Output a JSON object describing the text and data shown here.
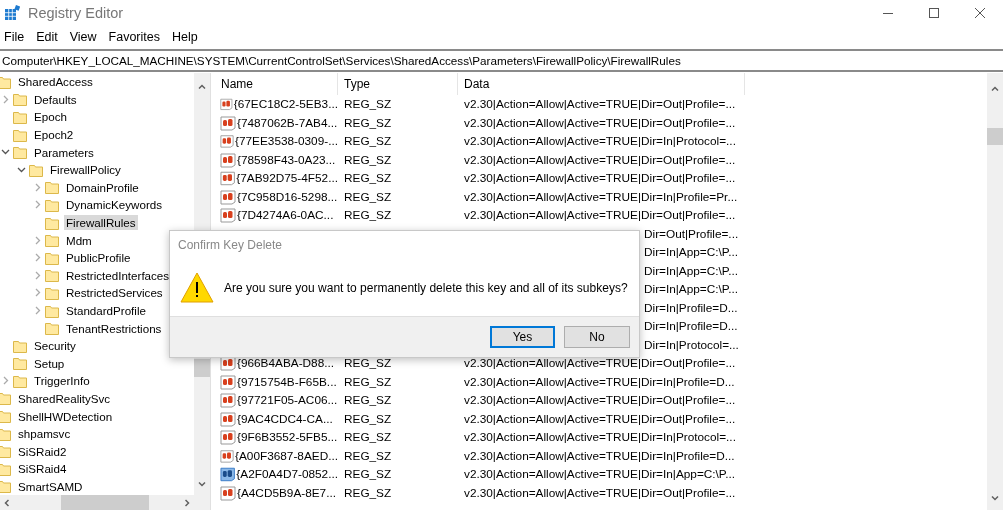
{
  "window": {
    "title": "Registry Editor"
  },
  "menu": [
    "File",
    "Edit",
    "View",
    "Favorites",
    "Help"
  ],
  "address": "Computer\\HKEY_LOCAL_MACHINE\\SYSTEM\\CurrentControlSet\\Services\\SharedAccess\\Parameters\\FirewallPolicy\\FirewallRules",
  "tree": [
    {
      "label": "SharedAccess",
      "selected": false,
      "children": [
        {
          "label": "Defaults",
          "expanded": false,
          "selected": false
        },
        {
          "label": "Epoch",
          "selected": false
        },
        {
          "label": "Epoch2",
          "selected": false
        },
        {
          "label": "Parameters",
          "expanded": true,
          "selected": false,
          "children": [
            {
              "label": "FirewallPolicy",
              "expanded": true,
              "selected": false,
              "children": [
                {
                  "label": "DomainProfile",
                  "expanded": false,
                  "selected": false
                },
                {
                  "label": "DynamicKeywords",
                  "expanded": false,
                  "selected": false
                },
                {
                  "label": "FirewallRules",
                  "selected": true
                },
                {
                  "label": "Mdm",
                  "expanded": false,
                  "selected": false
                },
                {
                  "label": "PublicProfile",
                  "expanded": false,
                  "selected": false
                },
                {
                  "label": "RestrictedInterfaces",
                  "expanded": false,
                  "selected": false
                },
                {
                  "label": "RestrictedServices",
                  "expanded": false,
                  "selected": false
                },
                {
                  "label": "StandardProfile",
                  "expanded": false,
                  "selected": false
                },
                {
                  "label": "TenantRestrictions",
                  "selected": false
                }
              ]
            }
          ]
        },
        {
          "label": "Security",
          "selected": false
        },
        {
          "label": "Setup",
          "selected": false
        },
        {
          "label": "TriggerInfo",
          "expanded": false,
          "selected": false
        }
      ]
    },
    {
      "label": "SharedRealitySvc",
      "selected": false
    },
    {
      "label": "ShellHWDetection",
      "selected": false
    },
    {
      "label": "shpamsvc",
      "selected": false
    },
    {
      "label": "SiSRaid2",
      "selected": false
    },
    {
      "label": "SiSRaid4",
      "selected": false
    },
    {
      "label": "SmartSAMD",
      "selected": false
    }
  ],
  "table": {
    "columns": [
      "Name",
      "Type",
      "Data"
    ],
    "rows": [
      {
        "kind": "value",
        "name": "{67EC18C2-5EB3...",
        "type": "REG_SZ",
        "data": "v2.30|Action=Allow|Active=TRUE|Dir=Out|Profile=...",
        "selected": false
      },
      {
        "kind": "value",
        "name": "{7487062B-7AB4...",
        "type": "REG_SZ",
        "data": "v2.30|Action=Allow|Active=TRUE|Dir=Out|Profile=...",
        "selected": false
      },
      {
        "kind": "value",
        "name": "{77EE3538-0309-...",
        "type": "REG_SZ",
        "data": "v2.30|Action=Allow|Active=TRUE|Dir=In|Protocol=...",
        "selected": false
      },
      {
        "kind": "value",
        "name": "{78598F43-0A23...",
        "type": "REG_SZ",
        "data": "v2.30|Action=Allow|Active=TRUE|Dir=Out|Profile=...",
        "selected": false
      },
      {
        "kind": "value",
        "name": "{7AB92D75-4F52...",
        "type": "REG_SZ",
        "data": "v2.30|Action=Allow|Active=TRUE|Dir=Out|Profile=...",
        "selected": false
      },
      {
        "kind": "value",
        "name": "{7C958D16-5298...",
        "type": "REG_SZ",
        "data": "v2.30|Action=Allow|Active=TRUE|Dir=In|Profile=Pr...",
        "selected": false
      },
      {
        "kind": "value",
        "name": "{7D4274A6-0AC...",
        "type": "REG_SZ",
        "data": "v2.30|Action=Allow|Active=TRUE|Dir=Out|Profile=...",
        "selected": false
      },
      {
        "kind": "covered",
        "data": "Dir=Out|Profile=..."
      },
      {
        "kind": "covered",
        "data": "Dir=In|App=C:\\P..."
      },
      {
        "kind": "covered",
        "data": "Dir=In|App=C:\\P..."
      },
      {
        "kind": "covered",
        "data": "Dir=In|App=C:\\P..."
      },
      {
        "kind": "covered",
        "data": "Dir=In|Profile=D..."
      },
      {
        "kind": "covered",
        "data": "Dir=In|Profile=D..."
      },
      {
        "kind": "covered",
        "data": "Dir=In|Protocol=..."
      },
      {
        "kind": "value",
        "name": "{966B4ABA-D88...",
        "type": "REG_SZ",
        "data": "v2.30|Action=Allow|Active=TRUE|Dir=Out|Profile=...",
        "selected": false
      },
      {
        "kind": "value",
        "name": "{9715754B-F65B...",
        "type": "REG_SZ",
        "data": "v2.30|Action=Allow|Active=TRUE|Dir=In|Profile=D...",
        "selected": false
      },
      {
        "kind": "value",
        "name": "{97721F05-AC06...",
        "type": "REG_SZ",
        "data": "v2.30|Action=Allow|Active=TRUE|Dir=Out|Profile=...",
        "selected": false
      },
      {
        "kind": "value",
        "name": "{9AC4CDC4-CA...",
        "type": "REG_SZ",
        "data": "v2.30|Action=Allow|Active=TRUE|Dir=Out|Profile=...",
        "selected": false
      },
      {
        "kind": "value",
        "name": "{9F6B3552-5FB5...",
        "type": "REG_SZ",
        "data": "v2.30|Action=Allow|Active=TRUE|Dir=In|Protocol=...",
        "selected": false
      },
      {
        "kind": "value",
        "name": "{A00F3687-8AED...",
        "type": "REG_SZ",
        "data": "v2.30|Action=Allow|Active=TRUE|Dir=In|Profile=D...",
        "selected": false
      },
      {
        "kind": "value",
        "name": "{A2F0A4D7-0852...",
        "type": "REG_SZ",
        "data": "v2.30|Action=Allow|Active=TRUE|Dir=In|App=C:\\P...",
        "selected": true
      },
      {
        "kind": "value",
        "name": "{A4CD5B9A-8E7...",
        "type": "REG_SZ",
        "data": "v2.30|Action=Allow|Active=TRUE|Dir=Out|Profile=...",
        "selected": false
      }
    ]
  },
  "dialog": {
    "title": "Confirm Key Delete",
    "message": "Are you sure you want to permanently delete this key and all of its subkeys?",
    "buttons": [
      {
        "label": "Yes",
        "default": true
      },
      {
        "label": "No",
        "default": false
      }
    ]
  }
}
